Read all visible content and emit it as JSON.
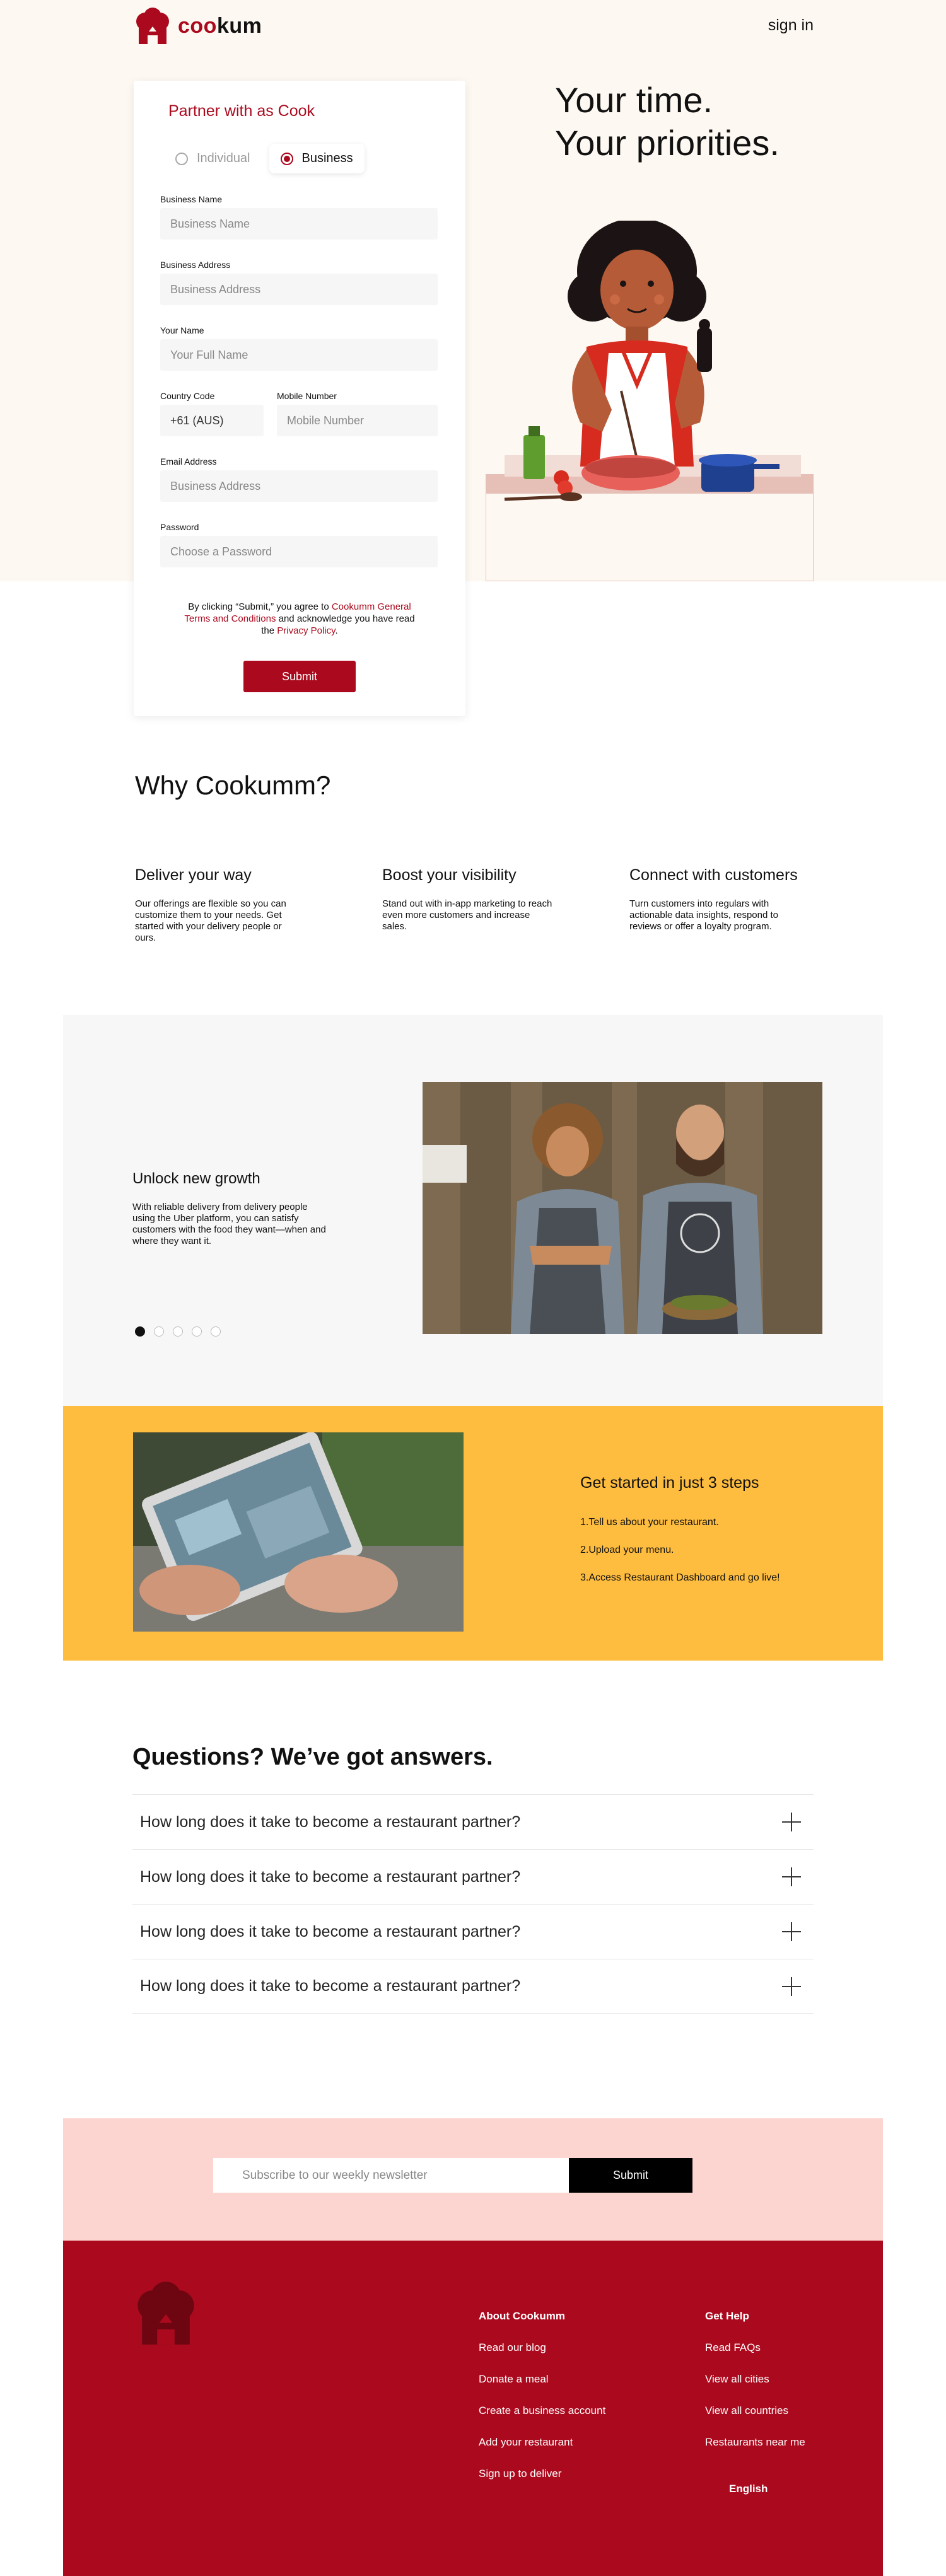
{
  "brand": {
    "name_prefix": "coo",
    "name_suffix": "kum",
    "accent": "#ab0a1e"
  },
  "header": {
    "signin": "sign in"
  },
  "form": {
    "title": "Partner with as Cook",
    "options": [
      "Individual",
      "Business"
    ],
    "selected_option": "Business",
    "business_name": {
      "label": "Business Name",
      "placeholder": "Business Name"
    },
    "business_address": {
      "label": "Business Address",
      "placeholder": "Business Address"
    },
    "your_name": {
      "label": "Your Name",
      "placeholder": "Your Full Name"
    },
    "country_code": {
      "label": "Country Code",
      "value": "+61 (AUS)"
    },
    "mobile": {
      "label": "Mobile Number",
      "placeholder": "Mobile Number"
    },
    "email": {
      "label": "Email Address",
      "placeholder": "Business Address"
    },
    "password": {
      "label": "Password",
      "placeholder": "Choose a Password"
    },
    "terms_pre": "By clicking “Submit,” you agree to ",
    "terms_link": "Cookumm General Terms and Conditions",
    "terms_mid": " and acknowledge you have read the ",
    "privacy_link": "Privacy Policy",
    "terms_end": ".",
    "submit": "Submit"
  },
  "hero": {
    "line1": "Your time.",
    "line2": "Your priorities."
  },
  "why": {
    "title": "Why Cookumm?",
    "items": [
      {
        "title": "Deliver your way",
        "text": "Our offerings are flexible so you can customize them to your needs. Get started with your delivery people or ours."
      },
      {
        "title": "Boost your visibility",
        "text": "Stand out with in-app marketing to reach even more customers and increase sales."
      },
      {
        "title": "Connect with customers",
        "text": "Turn customers into regulars with actionable data insights, respond to reviews or offer a loyalty program."
      }
    ]
  },
  "growth": {
    "title": "Unlock new growth",
    "text": "With reliable delivery from delivery people using the Uber platform, you can satisfy customers with the food they want—when and where they want it.",
    "slide_count": 5,
    "active_slide": 1
  },
  "steps": {
    "title": "Get started in just 3 steps",
    "items": [
      "1.Tell us about your restaurant.",
      "2.Upload your menu.",
      "3.Access Restaurant Dashboard and go live!"
    ],
    "bg": "#ffbd3f"
  },
  "faq": {
    "title": "Questions? We’ve got answers.",
    "items": [
      "How long does it take to become a restaurant partner?",
      "How long does it take to become a restaurant partner?",
      "How long does it take to become a restaurant partner?",
      "How long does it take to become a restaurant partner?"
    ]
  },
  "newsletter": {
    "placeholder": "Subscribe to our weekly newsletter",
    "button": "Submit"
  },
  "footer": {
    "col1": {
      "title": "About Cookumm",
      "links": [
        "Read our blog",
        "Donate a meal",
        "Create a business account",
        "Add your restaurant",
        "Sign up to deliver"
      ]
    },
    "col2": {
      "title": "Get Help",
      "links": [
        "Read FAQs",
        "View all cities",
        "View all countries",
        "Restaurants near me"
      ]
    },
    "language": "English"
  }
}
